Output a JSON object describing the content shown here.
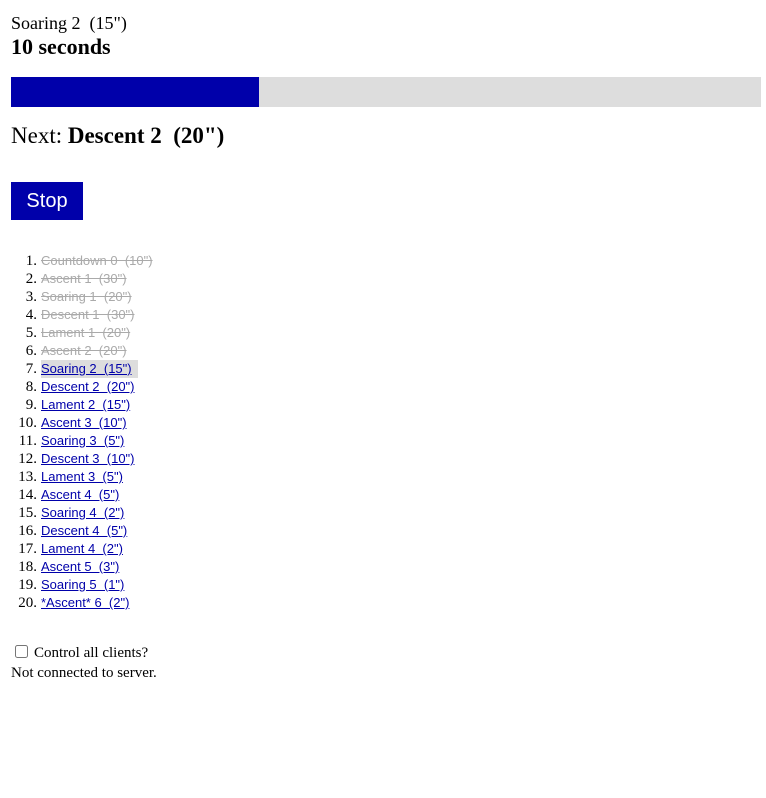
{
  "current": {
    "name": "Soaring 2  (15\")",
    "time_left": "10 seconds",
    "progress_fraction": 0.33
  },
  "next": {
    "prefix": "Next: ",
    "name": "Descent 2  (20\")"
  },
  "stop_label": "Stop",
  "schedule": [
    {
      "num": "1.",
      "label": "Countdown 0  (10\")",
      "state": "done"
    },
    {
      "num": "2.",
      "label": "Ascent 1  (30\")",
      "state": "done"
    },
    {
      "num": "3.",
      "label": "Soaring 1  (20\")",
      "state": "done"
    },
    {
      "num": "4.",
      "label": "Descent 1  (30\")",
      "state": "done"
    },
    {
      "num": "5.",
      "label": "Lament 1  (20\")",
      "state": "done"
    },
    {
      "num": "6.",
      "label": "Ascent 2  (20\")",
      "state": "done"
    },
    {
      "num": "7.",
      "label": "Soaring 2  (15\")",
      "state": "active"
    },
    {
      "num": "8.",
      "label": "Descent 2  (20\")",
      "state": "pending"
    },
    {
      "num": "9.",
      "label": "Lament 2  (15\")",
      "state": "pending"
    },
    {
      "num": "10.",
      "label": "Ascent 3  (10\")",
      "state": "pending"
    },
    {
      "num": "11.",
      "label": "Soaring 3  (5\")",
      "state": "pending"
    },
    {
      "num": "12.",
      "label": "Descent 3  (10\")",
      "state": "pending"
    },
    {
      "num": "13.",
      "label": "Lament 3  (5\")",
      "state": "pending"
    },
    {
      "num": "14.",
      "label": "Ascent 4  (5\")",
      "state": "pending"
    },
    {
      "num": "15.",
      "label": "Soaring 4  (2\")",
      "state": "pending"
    },
    {
      "num": "16.",
      "label": "Descent 4  (5\")",
      "state": "pending"
    },
    {
      "num": "17.",
      "label": "Lament 4  (2\")",
      "state": "pending"
    },
    {
      "num": "18.",
      "label": "Ascent 5  (3\")",
      "state": "pending"
    },
    {
      "num": "19.",
      "label": "Soaring 5  (1\")",
      "state": "pending"
    },
    {
      "num": "20.",
      "label": "*Ascent* 6  (2\")",
      "state": "pending"
    }
  ],
  "control": {
    "label": "Control all clients?",
    "checked": false
  },
  "status": "Not connected to server.",
  "colors": {
    "accent": "#0000aa",
    "track": "#dddddd",
    "done_text": "#aaaaaa"
  }
}
